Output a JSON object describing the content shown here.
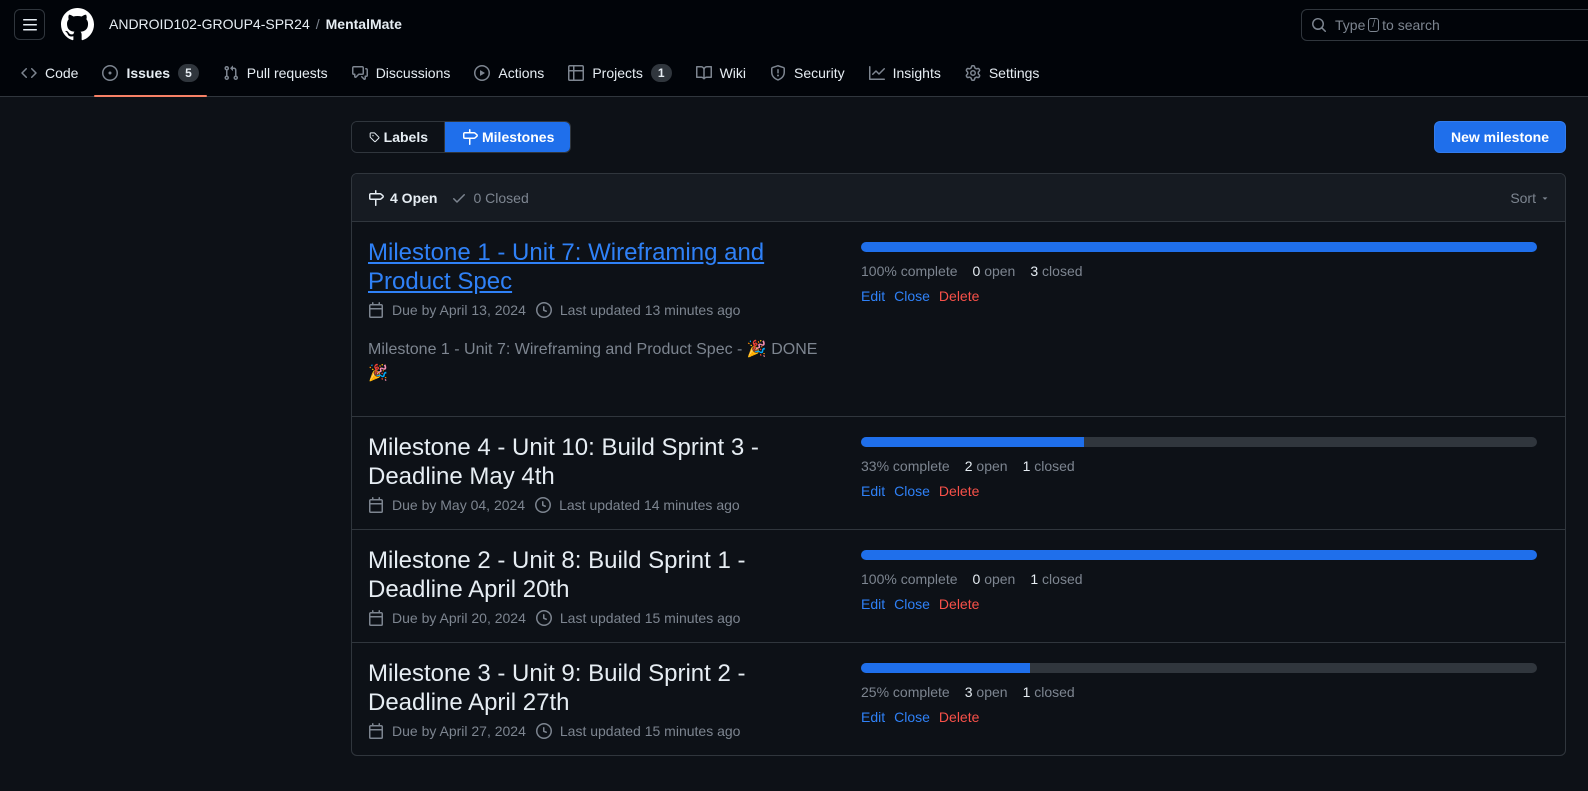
{
  "header": {
    "owner": "ANDROID102-GROUP4-SPR24",
    "separator": "/",
    "repo": "MentalMate",
    "search_prefix": "Type",
    "search_key": "/",
    "search_suffix": "to search"
  },
  "tabs": [
    {
      "label": "Code",
      "icon": "code-icon"
    },
    {
      "label": "Issues",
      "icon": "issue-opened-icon",
      "count": "5",
      "active": true
    },
    {
      "label": "Pull requests",
      "icon": "git-pull-request-icon"
    },
    {
      "label": "Discussions",
      "icon": "comment-discussion-icon"
    },
    {
      "label": "Actions",
      "icon": "play-icon"
    },
    {
      "label": "Projects",
      "icon": "table-icon",
      "count": "1"
    },
    {
      "label": "Wiki",
      "icon": "book-icon"
    },
    {
      "label": "Security",
      "icon": "shield-icon"
    },
    {
      "label": "Insights",
      "icon": "graph-icon"
    },
    {
      "label": "Settings",
      "icon": "gear-icon"
    }
  ],
  "toolbar": {
    "labels_label": "Labels",
    "milestones_label": "Milestones",
    "new_milestone_label": "New milestone"
  },
  "list_header": {
    "open_label": "4 Open",
    "closed_label": "0 Closed",
    "sort_label": "Sort"
  },
  "colors": {
    "accent": "#1f6feb",
    "link": "#2f81f7",
    "danger": "#f85149",
    "tab_underline": "#f78166"
  },
  "milestones": [
    {
      "title": "Milestone 1 - Unit 7: Wireframing and Product Spec",
      "linked": true,
      "due": "Due by April 13, 2024",
      "updated": "Last updated 13 minutes ago",
      "description": "Milestone 1 - Unit 7: Wireframing and Product Spec - 🎉 DONE 🎉",
      "progress": 1.0,
      "complete": "100% complete",
      "open_num": "0",
      "open_word": "open",
      "closed_num": "3",
      "closed_word": "closed"
    },
    {
      "title": "Milestone 4 - Unit 10: Build Sprint 3 - Deadline May 4th",
      "linked": false,
      "due": "Due by May 04, 2024",
      "updated": "Last updated 14 minutes ago",
      "description": "",
      "progress": 0.33,
      "complete": "33% complete",
      "open_num": "2",
      "open_word": "open",
      "closed_num": "1",
      "closed_word": "closed"
    },
    {
      "title": "Milestone 2 - Unit 8: Build Sprint 1 - Deadline April 20th",
      "linked": false,
      "due": "Due by April 20, 2024",
      "updated": "Last updated 15 minutes ago",
      "description": "",
      "progress": 1.0,
      "complete": "100% complete",
      "open_num": "0",
      "open_word": "open",
      "closed_num": "1",
      "closed_word": "closed"
    },
    {
      "title": "Milestone 3 - Unit 9: Build Sprint 2 - Deadline April 27th",
      "linked": false,
      "due": "Due by April 27, 2024",
      "updated": "Last updated 15 minutes ago",
      "description": "",
      "progress": 0.25,
      "complete": "25% complete",
      "open_num": "3",
      "open_word": "open",
      "closed_num": "1",
      "closed_word": "closed"
    }
  ],
  "milestone_actions": {
    "edit": "Edit",
    "close": "Close",
    "delete": "Delete"
  }
}
